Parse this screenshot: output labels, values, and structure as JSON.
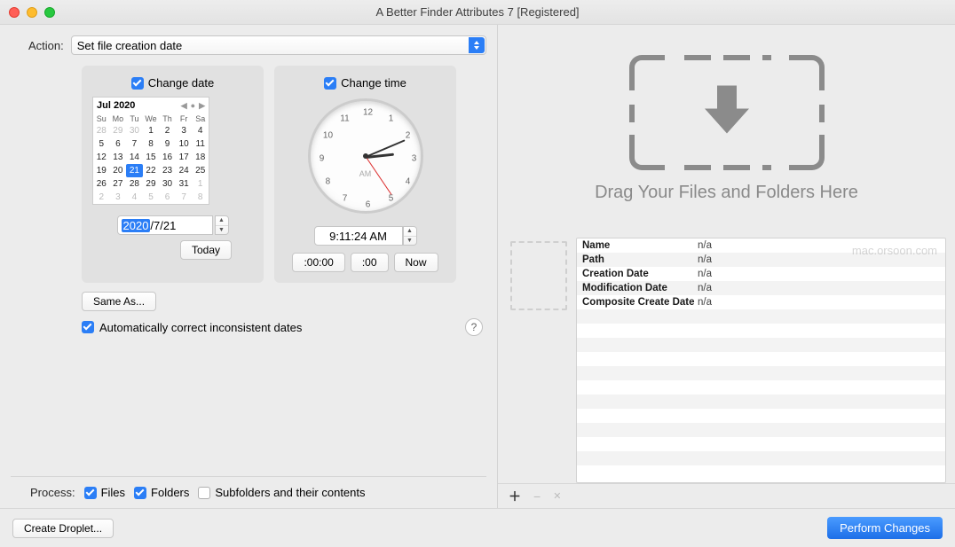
{
  "window": {
    "title": "A Better Finder Attributes 7 [Registered]"
  },
  "action": {
    "label": "Action:",
    "value": "Set file creation date"
  },
  "change_date": {
    "checkbox_label": "Change date",
    "month_year": "Jul 2020",
    "dow": [
      "Su",
      "Mo",
      "Tu",
      "We",
      "Th",
      "Fr",
      "Sa"
    ],
    "weeks": [
      [
        {
          "d": "28",
          "dim": true
        },
        {
          "d": "29",
          "dim": true
        },
        {
          "d": "30",
          "dim": true
        },
        {
          "d": "1"
        },
        {
          "d": "2"
        },
        {
          "d": "3"
        },
        {
          "d": "4"
        }
      ],
      [
        {
          "d": "5"
        },
        {
          "d": "6"
        },
        {
          "d": "7"
        },
        {
          "d": "8"
        },
        {
          "d": "9"
        },
        {
          "d": "10"
        },
        {
          "d": "11"
        }
      ],
      [
        {
          "d": "12"
        },
        {
          "d": "13"
        },
        {
          "d": "14"
        },
        {
          "d": "15"
        },
        {
          "d": "16"
        },
        {
          "d": "17"
        },
        {
          "d": "18"
        }
      ],
      [
        {
          "d": "19"
        },
        {
          "d": "20"
        },
        {
          "d": "21",
          "sel": true
        },
        {
          "d": "22"
        },
        {
          "d": "23"
        },
        {
          "d": "24"
        },
        {
          "d": "25"
        }
      ],
      [
        {
          "d": "26"
        },
        {
          "d": "27"
        },
        {
          "d": "28"
        },
        {
          "d": "29"
        },
        {
          "d": "30"
        },
        {
          "d": "31"
        },
        {
          "d": "1",
          "dim": true
        }
      ],
      [
        {
          "d": "2",
          "dim": true
        },
        {
          "d": "3",
          "dim": true
        },
        {
          "d": "4",
          "dim": true
        },
        {
          "d": "5",
          "dim": true
        },
        {
          "d": "6",
          "dim": true
        },
        {
          "d": "7",
          "dim": true
        },
        {
          "d": "8",
          "dim": true
        }
      ]
    ],
    "year": "2020",
    "md": "7/21",
    "today_btn": "Today"
  },
  "change_time": {
    "checkbox_label": "Change time",
    "ampm_on_clock": "AM",
    "time_value": "9:11:24 AM",
    "btn_zero": ":00:00",
    "btn_zeromin": ":00",
    "btn_now": "Now",
    "numbers": [
      "12",
      "1",
      "2",
      "3",
      "4",
      "5",
      "6",
      "7",
      "8",
      "9",
      "10",
      "11"
    ]
  },
  "same_as_btn": "Same As...",
  "auto_correct_label": "Automatically correct inconsistent dates",
  "help_symbol": "?",
  "process": {
    "label": "Process:",
    "files": "Files",
    "folders": "Folders",
    "subfolders": "Subfolders and their contents"
  },
  "dropzone_text": "Drag Your Files and Folders Here",
  "meta": [
    {
      "k": "Name",
      "v": "n/a"
    },
    {
      "k": "Path",
      "v": "n/a"
    },
    {
      "k": "Creation Date",
      "v": "n/a"
    },
    {
      "k": "Modification Date",
      "v": "n/a"
    },
    {
      "k": "Composite Create Date",
      "v": "n/a"
    }
  ],
  "tool_icons": {
    "add": "＋",
    "remove": "−",
    "clear": "✕"
  },
  "bottom": {
    "droplet": "Create Droplet...",
    "perform": "Perform Changes"
  },
  "watermark": "mac.orsoon.com"
}
